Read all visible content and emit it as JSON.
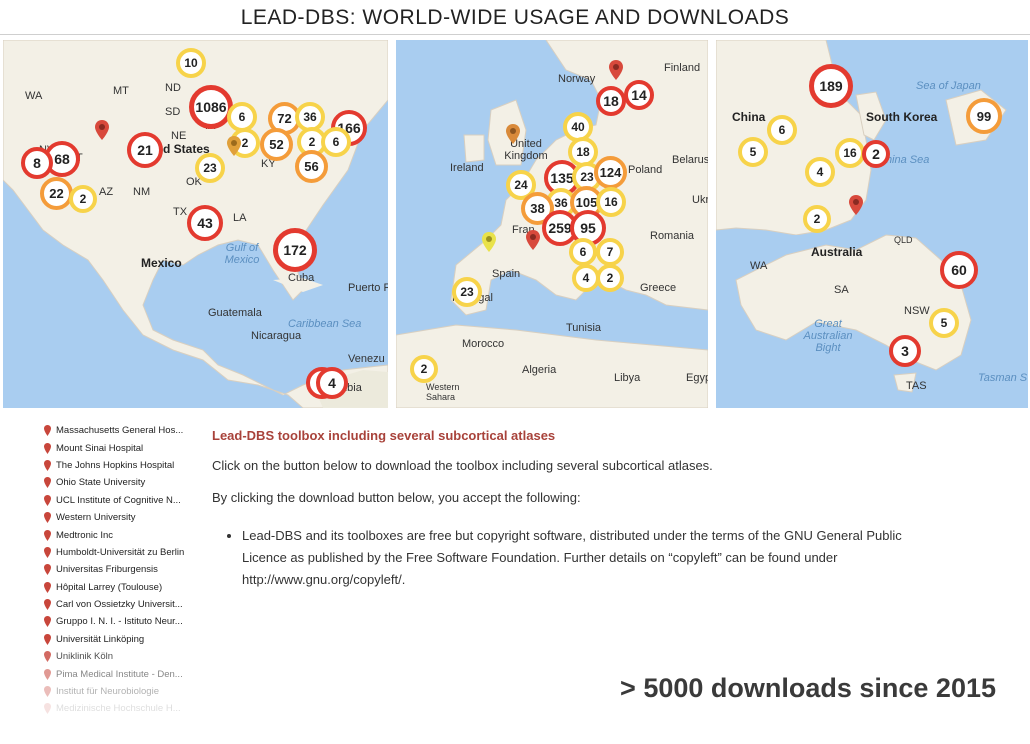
{
  "title": "LEAD-DBS: WORLD-WIDE USAGE AND DOWNLOADS",
  "map_na": {
    "labels": [
      "WA",
      "MT",
      "ND",
      "SD",
      "NE",
      "UT",
      "NV",
      "AZ",
      "NM",
      "TX",
      "OK",
      "LA",
      "KY",
      "d States",
      "IA",
      "Mexico",
      "Gulf of Mexico",
      "Cuba",
      "Puerto R",
      "Guatemala",
      "Caribbean Sea",
      "Nicaragua",
      "Venezu",
      "mbia"
    ],
    "clusters": [
      "10",
      "1086",
      "6",
      "72",
      "36",
      "166",
      "2",
      "52",
      "2",
      "6",
      "21",
      "68",
      "8",
      "23",
      "56",
      "22",
      "2",
      "43",
      "172",
      "5",
      "4"
    ]
  },
  "map_eu": {
    "labels": [
      "Finland",
      "Norway",
      "Ireland",
      "United Kingdom",
      "Belarus",
      "Poland",
      "Ukr",
      "Romania",
      "Spain",
      "Portugal",
      "Greece",
      "Tunisia",
      "Morocco",
      "Algeria",
      "Libya",
      "Egyp",
      "Western Sahara",
      "Fran"
    ],
    "clusters": [
      "18",
      "14",
      "40",
      "18",
      "135",
      "23",
      "124",
      "24",
      "36",
      "105",
      "16",
      "38",
      "259",
      "95",
      "6",
      "7",
      "4",
      "2",
      "23",
      "2"
    ]
  },
  "map_asia": {
    "labels": [
      "China",
      "South Korea",
      "Sea of Japan",
      "China Sea",
      "Australia",
      "WA",
      "SA",
      "NSW",
      "Great Australian Bight",
      "TAS",
      "Tasman S",
      "QLD"
    ],
    "clusters": [
      "189",
      "6",
      "99",
      "5",
      "16",
      "2",
      "4",
      "2",
      "60",
      "5",
      "3"
    ]
  },
  "sites": [
    "Massachusetts General Hos...",
    "Mount Sinai Hospital",
    "The Johns Hopkins Hospital",
    "Ohio State University",
    "UCL Institute of Cognitive N...",
    "Western University",
    "Medtronic Inc",
    "Humboldt-Universität zu Berlin",
    "Universitas Friburgensis",
    "Hôpital Larrey (Toulouse)",
    "Carl von Ossietzky Universit...",
    "Gruppo I. N. I. - Istituto Neur...",
    "Universität Linköping",
    "Uniklinik Köln",
    "Pima Medical Institute - Den...",
    "Institut für Neurobiologie",
    "Medizinische Hochschule H..."
  ],
  "content": {
    "heading": "Lead-DBS toolbox including several subcortical atlases",
    "p1": "Click on the button below to download the toolbox including several subcortical atlases.",
    "p2": "By clicking the download button below, you accept the following:",
    "bullet1": "Lead-DBS and its toolboxes are free but copyright software, distributed under the terms of the GNU General Public Licence as published by the Free Software Foundation. Further details on “copyleft” can be found under http://www.gnu.org/copyleft/."
  },
  "downloads": "> 5000 downloads since 2015",
  "colors": {
    "accent": "#a8423a",
    "cluster_red": "#e33a2f",
    "cluster_orange": "#f49c3a",
    "cluster_yellow": "#f7d34a",
    "sea": "#a9cdf0",
    "land": "#f3f0e6"
  }
}
